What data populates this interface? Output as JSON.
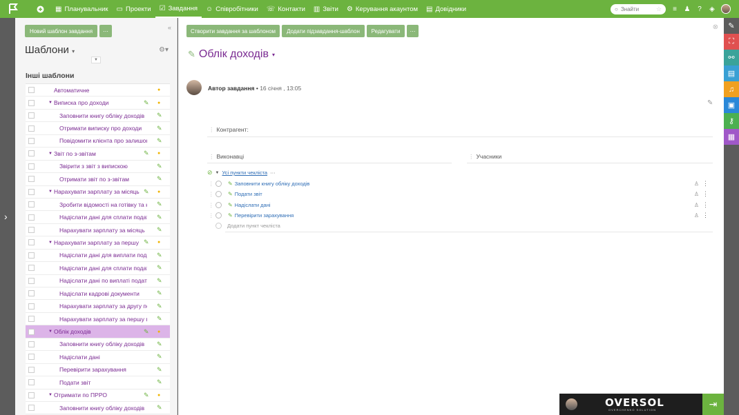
{
  "nav": {
    "items": [
      {
        "label": "Планувальник",
        "icon": "calendar-icon"
      },
      {
        "label": "Проекти",
        "icon": "folder-icon"
      },
      {
        "label": "Завдання",
        "icon": "tasks-icon",
        "active": true
      },
      {
        "label": "Співробітники",
        "icon": "people-icon"
      },
      {
        "label": "Контакти",
        "icon": "contacts-icon"
      },
      {
        "label": "Звіти",
        "icon": "chart-icon"
      },
      {
        "label": "Керування акаунтом",
        "icon": "settings-icon"
      },
      {
        "label": "Довідники",
        "icon": "book-icon"
      }
    ],
    "search_placeholder": "Знайти"
  },
  "sidebar": {
    "new_template_btn": "Новий шаблон завдання",
    "more_btn": "⋯",
    "title": "Шаблони",
    "section": "Інші шаблони",
    "rows": [
      {
        "label": "Автоматичне",
        "level": 0,
        "tri": false,
        "clip": false,
        "bulb": true,
        "selected": false
      },
      {
        "label": "Виписка про доходи",
        "level": 0,
        "tri": true,
        "clip": true,
        "bulb": true,
        "selected": false
      },
      {
        "label": "Заповнити книгу обліку доходів",
        "level": 1,
        "tri": false,
        "clip": true,
        "bulb": false,
        "selected": false
      },
      {
        "label": "Отримати виписку про доходи",
        "level": 1,
        "tri": false,
        "clip": true,
        "bulb": false,
        "selected": false
      },
      {
        "label": "Повідомити клієнта про залишок",
        "level": 1,
        "tri": false,
        "clip": true,
        "bulb": false,
        "selected": false
      },
      {
        "label": "Звіт по з-звітам",
        "level": 0,
        "tri": true,
        "clip": true,
        "bulb": true,
        "selected": false
      },
      {
        "label": "Звірити з звіт з випискою",
        "level": 1,
        "tri": false,
        "clip": true,
        "bulb": false,
        "selected": false
      },
      {
        "label": "Отримати звіт по з-звітам",
        "level": 1,
        "tri": false,
        "clip": true,
        "bulb": false,
        "selected": false
      },
      {
        "label": "Нарахувати зарплату за місяць",
        "level": 0,
        "tri": true,
        "clip": true,
        "bulb": true,
        "selected": false
      },
      {
        "label": "Зробити відомості на готівку та на",
        "level": 1,
        "tri": false,
        "clip": true,
        "bulb": false,
        "selected": false
      },
      {
        "label": "Надіслати дані для сплати податків",
        "level": 1,
        "tri": false,
        "clip": true,
        "bulb": false,
        "selected": false
      },
      {
        "label": "Нарахувати зарплату за місяць",
        "level": 1,
        "tri": false,
        "clip": true,
        "bulb": false,
        "selected": false
      },
      {
        "label": "Нарахувати зарплату за першу",
        "level": 0,
        "tri": true,
        "clip": true,
        "bulb": true,
        "selected": false
      },
      {
        "label": "Надіслати дані для виплати податків",
        "level": 1,
        "tri": false,
        "clip": true,
        "bulb": false,
        "selected": false
      },
      {
        "label": "Надіслати дані для сплати податків",
        "level": 1,
        "tri": false,
        "clip": true,
        "bulb": false,
        "selected": false
      },
      {
        "label": "Надіслати дані по виплаті податків",
        "level": 1,
        "tri": false,
        "clip": true,
        "bulb": false,
        "selected": false
      },
      {
        "label": "Надіслати кадрові документи",
        "level": 1,
        "tri": false,
        "clip": true,
        "bulb": false,
        "selected": false
      },
      {
        "label": "Нарахувати зарплату за другу половину",
        "level": 1,
        "tri": false,
        "clip": true,
        "bulb": false,
        "selected": false
      },
      {
        "label": "Нарахувати зарплату за першу половину",
        "level": 1,
        "tri": false,
        "clip": true,
        "bulb": false,
        "selected": false
      },
      {
        "label": "Облік доходів",
        "level": 0,
        "tri": true,
        "clip": true,
        "bulb": true,
        "selected": true
      },
      {
        "label": "Заповнити книгу обліку доходів",
        "level": 1,
        "tri": false,
        "clip": true,
        "bulb": false,
        "selected": false
      },
      {
        "label": "Надіслати дані",
        "level": 1,
        "tri": false,
        "clip": true,
        "bulb": false,
        "selected": false
      },
      {
        "label": "Перевірити зарахування",
        "level": 1,
        "tri": false,
        "clip": true,
        "bulb": false,
        "selected": false
      },
      {
        "label": "Подати звіт",
        "level": 1,
        "tri": false,
        "clip": true,
        "bulb": false,
        "selected": false
      },
      {
        "label": "Отримати по ПРРО",
        "level": 0,
        "tri": true,
        "clip": true,
        "bulb": true,
        "selected": false
      },
      {
        "label": "Заповнити книгу обліку доходів",
        "level": 1,
        "tri": false,
        "clip": true,
        "bulb": false,
        "selected": false
      }
    ]
  },
  "main": {
    "buttons": {
      "create": "Створити завдання за шаблоном",
      "add_sub": "Додати підзавдання-шаблон",
      "edit": "Редагувати",
      "more": "⋯"
    },
    "title": "Облік доходів",
    "author_label": "Автор завдання",
    "date": "16 січня , 13:05",
    "counterparty_label": "Контрагент:",
    "executors_label": "Виконавці",
    "participants_label": "Учасники",
    "checklist": {
      "header": "Усі пункти чекліста",
      "items": [
        "Заповнити книгу обліку доходів",
        "Подати звіт",
        "Надіслати дані",
        "Перевірити зарахування"
      ],
      "add_placeholder": "Додати пункт чекліста"
    }
  },
  "promo": {
    "brand": "OVERSOL",
    "sub": "OVERCHENKO SOLUTION"
  },
  "colors": {
    "brand_green": "#6cb33f",
    "accent_purple": "#7a2a92",
    "selected_row": "#dcb4e8",
    "link_blue": "#2d6cb5"
  }
}
